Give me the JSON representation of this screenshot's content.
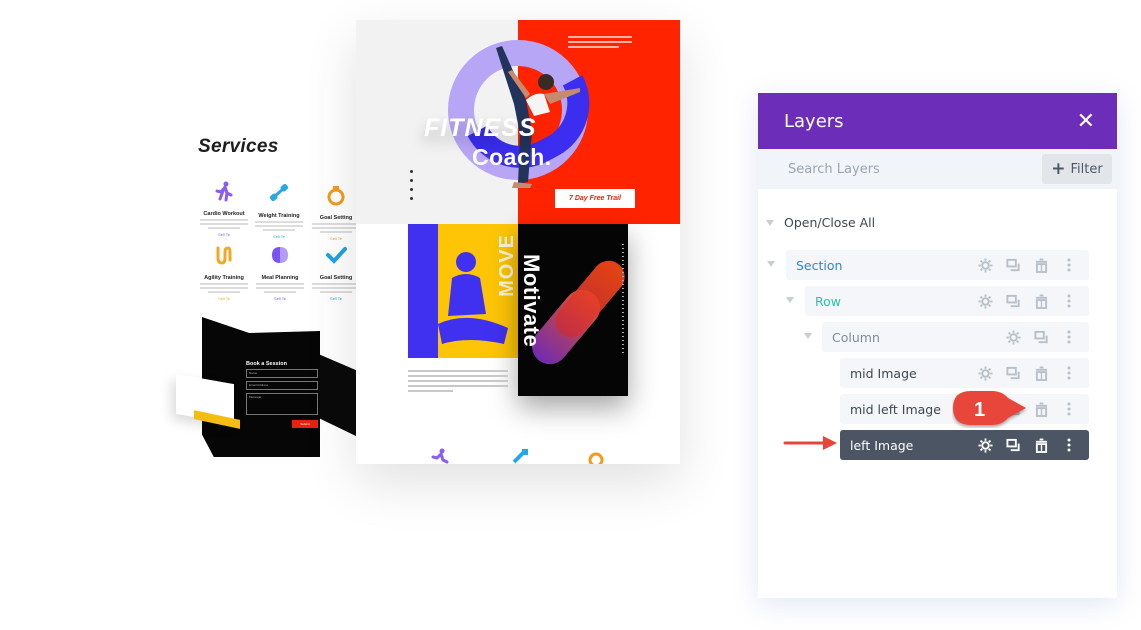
{
  "preview": {
    "left_page": {
      "title": "Services",
      "services": [
        {
          "name": "Cardio Workout",
          "more": "Sell Te",
          "icon": "runner-icon",
          "color": "#8a5cf6"
        },
        {
          "name": "Weight Training",
          "more": "Sell Te",
          "icon": "dumbbell-icon",
          "color": "#24a8e6"
        },
        {
          "name": "Goal Setting",
          "more": "Sell Te",
          "icon": "stopwatch-icon",
          "color": "#f59a1b"
        },
        {
          "name": "Agility Training",
          "more": "Sell Te",
          "icon": "jump-rope-icon",
          "color": "#f5a623"
        },
        {
          "name": "Meal Planning",
          "more": "Sell Te",
          "icon": "meal-icon",
          "color": "#7a52f5"
        },
        {
          "name": "Goal Setting",
          "more": "Sell Te",
          "icon": "checkmark-icon",
          "color": "#1fa3e0"
        }
      ],
      "contact_form": {
        "title": "Book a Session",
        "fields": [
          "Name",
          "Email Address",
          "Message"
        ],
        "submit": "Submit"
      }
    },
    "mid_page": {
      "hero_word1": "FITNESS",
      "hero_word2": "Coach.",
      "cta": "7 Day Free Trail",
      "move_word": "MOVE",
      "motivate_word": "Motivate"
    }
  },
  "layers_panel": {
    "title": "Layers",
    "close_label": "✕",
    "search_placeholder": "Search Layers",
    "filter_label": "Filter",
    "open_close_all": "Open/Close All",
    "items": [
      {
        "label": "Section",
        "type": "section",
        "color": "#2b87da"
      },
      {
        "label": "Row",
        "type": "row",
        "color": "#29c4a9"
      },
      {
        "label": "Column",
        "type": "column",
        "color": "#7e8a98"
      },
      {
        "label": "mid Image",
        "type": "module"
      },
      {
        "label": "mid left Image",
        "type": "module"
      },
      {
        "label": "left Image",
        "type": "module",
        "selected": true
      }
    ]
  },
  "annotation": {
    "callout_number": "1",
    "accent": "#e8443a"
  }
}
